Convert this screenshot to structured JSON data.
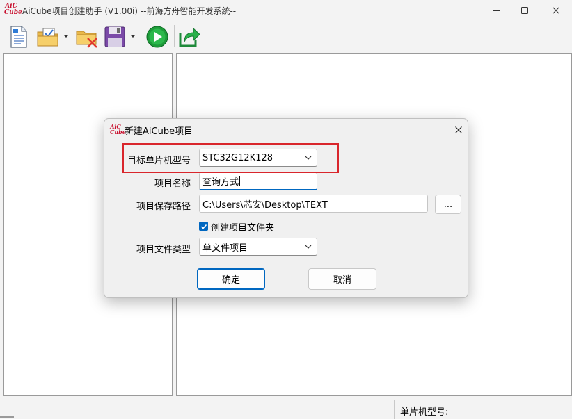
{
  "window": {
    "title": "AiCube项目创建助手 (V1.00i) --前海方舟智能开发系统--",
    "logo_top": "AiC",
    "logo_bottom": "Cube"
  },
  "toolbar": {
    "buttons": [
      "new-project-icon",
      "open-project-icon",
      "delete-project-icon",
      "save-icon",
      "run-icon",
      "export-icon"
    ]
  },
  "statusbar": {
    "mcu_label": "单片机型号:"
  },
  "dialog": {
    "title": "新建AiCube项目",
    "logo_top": "AiC",
    "logo_bottom": "Cube",
    "mcu_model": {
      "label": "目标单片机型号",
      "value": "STC32G12K128"
    },
    "project_name": {
      "label": "项目名称",
      "value": "查询方式"
    },
    "project_path": {
      "label": "项目保存路径",
      "value": "C:\\Users\\芯安\\Desktop\\TEXT",
      "browse_label": "..."
    },
    "create_folder": {
      "label": "创建项目文件夹",
      "checked": true
    },
    "file_type": {
      "label": "项目文件类型",
      "value": "单文件项目"
    },
    "ok_label": "确定",
    "cancel_label": "取消"
  },
  "colors": {
    "accent": "#0067c0",
    "highlight": "#d9262c",
    "logo": "#c8102e"
  }
}
